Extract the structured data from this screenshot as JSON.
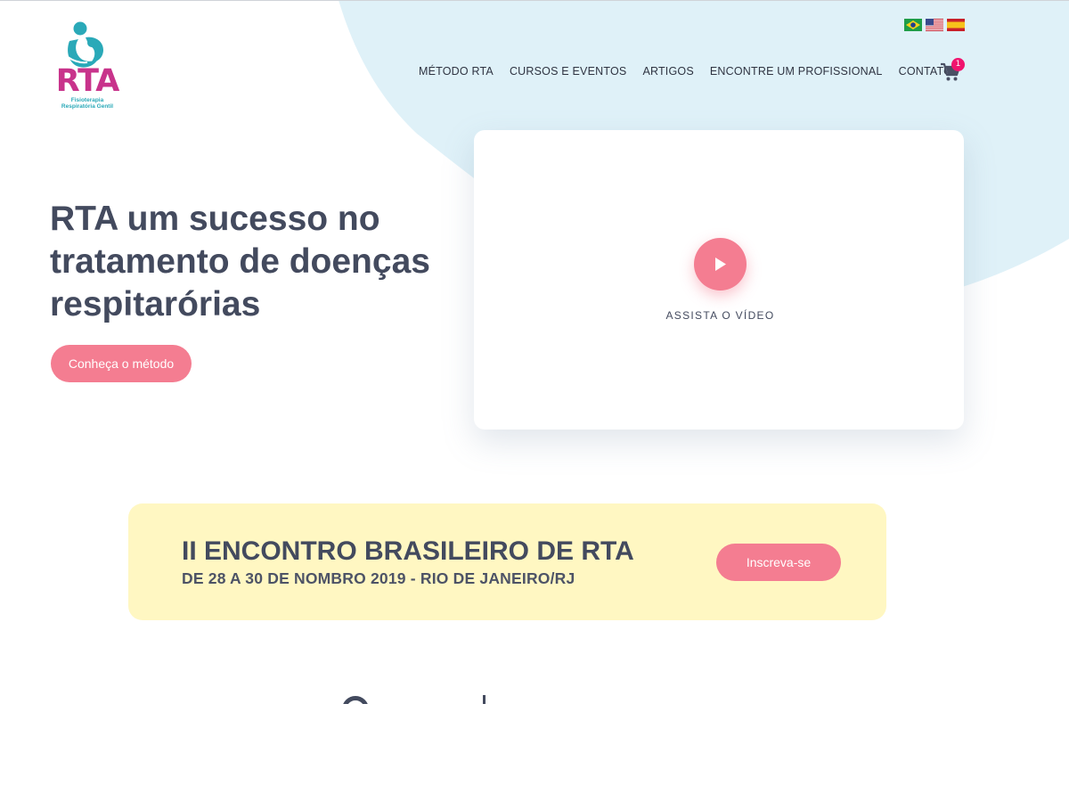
{
  "brand": {
    "logo_text": "RTA",
    "logo_subtitle_line1": "Fisioterapia",
    "logo_subtitle_line2": "Respiratória Gentil",
    "colors": {
      "magenta": "#c8338b",
      "teal": "#2aa9b8"
    }
  },
  "languages": [
    {
      "flag": "brazil-flag-icon"
    },
    {
      "flag": "usa-flag-icon"
    },
    {
      "flag": "spain-flag-icon"
    }
  ],
  "nav": {
    "items": [
      "MÉTODO RTA",
      "CURSOS E EVENTOS",
      "ARTIGOS",
      "ENCONTRE UM PROFISSIONAL",
      "CONTATO"
    ],
    "cart_icon": "shopping-cart-icon",
    "cart_count": "1"
  },
  "hero": {
    "title": "RTA um sucesso no tratamento de doenças respitarórias",
    "cta_label": "Conheça o método"
  },
  "video": {
    "play_icon": "play-icon",
    "label": "ASSISTA O VÍDEO"
  },
  "event": {
    "title": "II ENCONTRO BRASILEIRO DE RTA",
    "subtitle": "DE 28 A 30 DE NOMBRO 2019 - RIO DE JANEIRO/RJ",
    "cta_label": "Inscreva-se"
  },
  "theme": {
    "accent_pink": "#f47d91",
    "text_dark": "#434a5e",
    "bg_blue": "#dff1f8",
    "banner_yellow": "#fff7c2",
    "badge": "#f0146e"
  }
}
